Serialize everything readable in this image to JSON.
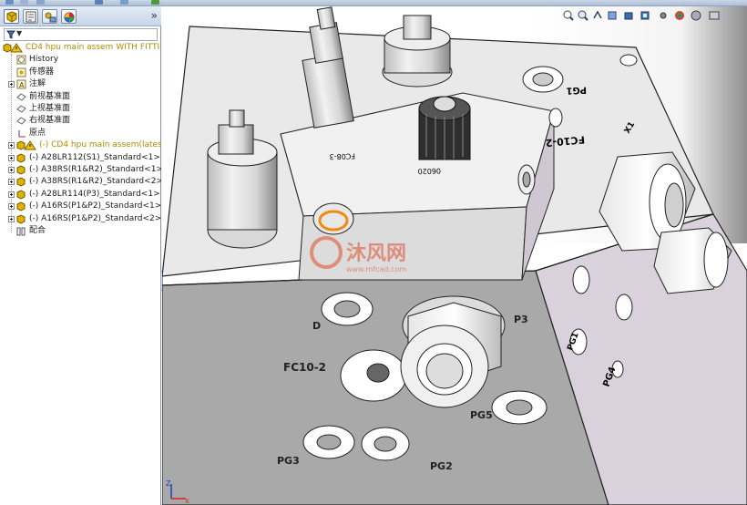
{
  "feature_tree": {
    "filter_symbol": "▼",
    "expand_symbol": "»",
    "items": [
      {
        "label": "CD4 hpu main assem WITH FITTI",
        "icon": "assembly-warning-icon",
        "color": "#b08d00",
        "indent": 0,
        "expand": false
      },
      {
        "label": "History",
        "icon": "history-folder-icon",
        "color": "#1a1a1a",
        "indent": 1,
        "expand": false
      },
      {
        "label": "传感器",
        "icon": "sensor-folder-icon",
        "color": "#1a1a1a",
        "indent": 1,
        "expand": false
      },
      {
        "label": "注解",
        "icon": "annotation-icon",
        "color": "#1a1a1a",
        "indent": 1,
        "expand": true
      },
      {
        "label": "前视基准面",
        "icon": "plane-icon",
        "color": "#1a1a1a",
        "indent": 1,
        "expand": false
      },
      {
        "label": "上视基准面",
        "icon": "plane-icon",
        "color": "#1a1a1a",
        "indent": 1,
        "expand": false
      },
      {
        "label": "右视基准面",
        "icon": "plane-icon",
        "color": "#1a1a1a",
        "indent": 1,
        "expand": false
      },
      {
        "label": "原点",
        "icon": "origin-icon",
        "color": "#1a1a1a",
        "indent": 1,
        "expand": false
      },
      {
        "label": "(-) CD4 hpu main assem(lates",
        "icon": "subassembly-warning-icon",
        "color": "#b08d00",
        "indent": 1,
        "expand": true
      },
      {
        "label": "(-) A28LR112(S1)_Standard<1> (",
        "icon": "part-icon",
        "color": "#1a1a1a",
        "indent": 1,
        "expand": true
      },
      {
        "label": "(-) A38RS(R1&R2)_Standard<1>",
        "icon": "part-icon",
        "color": "#1a1a1a",
        "indent": 1,
        "expand": true
      },
      {
        "label": "(-) A38RS(R1&R2)_Standard<2>",
        "icon": "part-icon",
        "color": "#1a1a1a",
        "indent": 1,
        "expand": true
      },
      {
        "label": "(-) A28LR114(P3)_Standard<1> (",
        "icon": "part-icon",
        "color": "#1a1a1a",
        "indent": 1,
        "expand": true
      },
      {
        "label": "(-) A16RS(P1&P2)_Standard<1> (",
        "icon": "part-icon",
        "color": "#1a1a1a",
        "indent": 1,
        "expand": true
      },
      {
        "label": "(-) A16RS(P1&P2)_Standard<2> (",
        "icon": "part-icon",
        "color": "#1a1a1a",
        "indent": 1,
        "expand": true
      },
      {
        "label": "配合",
        "icon": "mates-icon",
        "color": "#1a1a1a",
        "indent": 1,
        "expand": false
      }
    ]
  },
  "model_labels": {
    "pg1": "PG1",
    "fc10_2_top": "FC10-2",
    "x1": "X1",
    "fc08_3": "FC08-3",
    "part_06020": "06020",
    "d": "D",
    "p3": "P3",
    "fc10_2_front": "FC10-2",
    "pg5": "PG5",
    "pg3": "PG3",
    "pg2": "PG2",
    "pg4": "PG4",
    "pg1_side": "PG1"
  },
  "watermark": {
    "title": "沐风网",
    "url": "www.mfcad.com"
  },
  "triad": {
    "z": "Z",
    "x": "X"
  }
}
